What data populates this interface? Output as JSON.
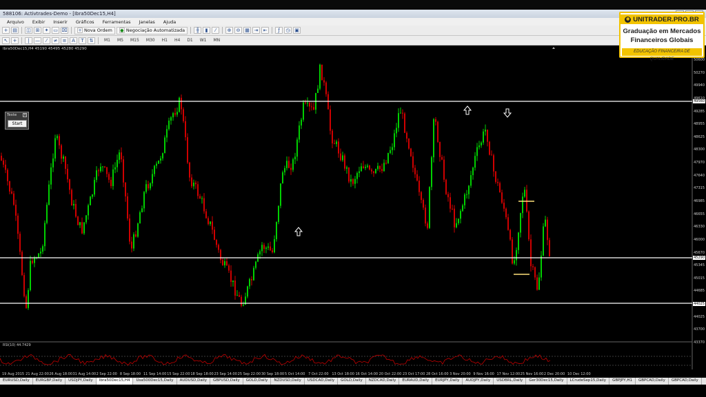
{
  "window": {
    "title": "588106: Activtrades-Demo - [Ibra50Dec15,H4]"
  },
  "menu": [
    "Arquivo",
    "Exibir",
    "Inserir",
    "Gráficos",
    "Ferramentas",
    "Janelas",
    "Ajuda"
  ],
  "toolbar": {
    "new_order": "Nova Ordem",
    "auto_trading": "Negociação Automatizada",
    "timeframes": [
      "M1",
      "M5",
      "M15",
      "M30",
      "H1",
      "H4",
      "D1",
      "W1",
      "MN"
    ]
  },
  "chart": {
    "symbol_info": "Ibra50Dec15,H4  45190 45495 45280 45290",
    "indicator_label": "RSI(10) 44.7429",
    "price_ticks": [
      "50600",
      "50270",
      "49940",
      "49610",
      "49285",
      "48955",
      "48625",
      "48300",
      "47970",
      "47640",
      "47315",
      "46985",
      "46655",
      "46330",
      "46000",
      "45670",
      "45345",
      "45015",
      "44685",
      "44355",
      "44025",
      "43700",
      "43370"
    ],
    "level_labels": [
      "49560",
      "45290",
      "44025"
    ],
    "date_ticks": [
      "19 Aug 2015",
      "21 Aug 22:00",
      "26 Aug 18:00",
      "31 Aug 14:00",
      "2 Sep 22:00",
      "8 Sep 18:00",
      "11 Sep 14:00",
      "15 Sep 22:00",
      "18 Sep 18:00",
      "23 Sep 14:00",
      "25 Sep 22:00",
      "30 Sep 18:00",
      "5 Oct 14:00",
      "7 Oct 22:00",
      "13 Oct 18:00",
      "16 Oct 14:00",
      "20 Oct 22:00",
      "23 Oct 17:00",
      "28 Oct 16:00",
      "3 Nov 20:00",
      "9 Nov 16:00",
      "17 Nov 12:00",
      "25 Nov 16:00",
      "2 Dec 20:00",
      "10 Dec 12:00"
    ],
    "colors": {
      "bull": "#00d000",
      "bear": "#d00000",
      "line": "#ffffff",
      "rsi": "#c00000",
      "hl": "#ffe27a"
    }
  },
  "test_panel": {
    "caption": "Teste",
    "start": "Start"
  },
  "tabs": [
    "EURUSD,Daily",
    "EURGBP,Daily",
    "USDJPY,Daily",
    "Ibra50Dec15,H4",
    "Usa500Dec15,Daily",
    "AUDUSD,Daily",
    "GBPUSD,Daily",
    "GOLD,Daily",
    "NZDUSD,Daily",
    "USDCAD,Daily",
    "GOLD,Daily",
    "NZDCAD,Daily",
    "EURAUD,Daily",
    "EURJPY,Daily",
    "AUDJPY,Daily",
    "USDBRL,Daily",
    "Ger30Dec15,Daily",
    "LCrudeSep15,Daily",
    "GBPJPY,H1",
    "GBPCAD,Daily",
    "GBPCAD,Daily"
  ],
  "active_tab": 3,
  "logo": {
    "brand": "UNITRADER.PRO.BR",
    "line1": "Graduação em Mercados",
    "line2": "Financeiros Globais",
    "tagline": "EDUCAÇÃO FINANCEIRA DE QUALIDADE"
  }
}
